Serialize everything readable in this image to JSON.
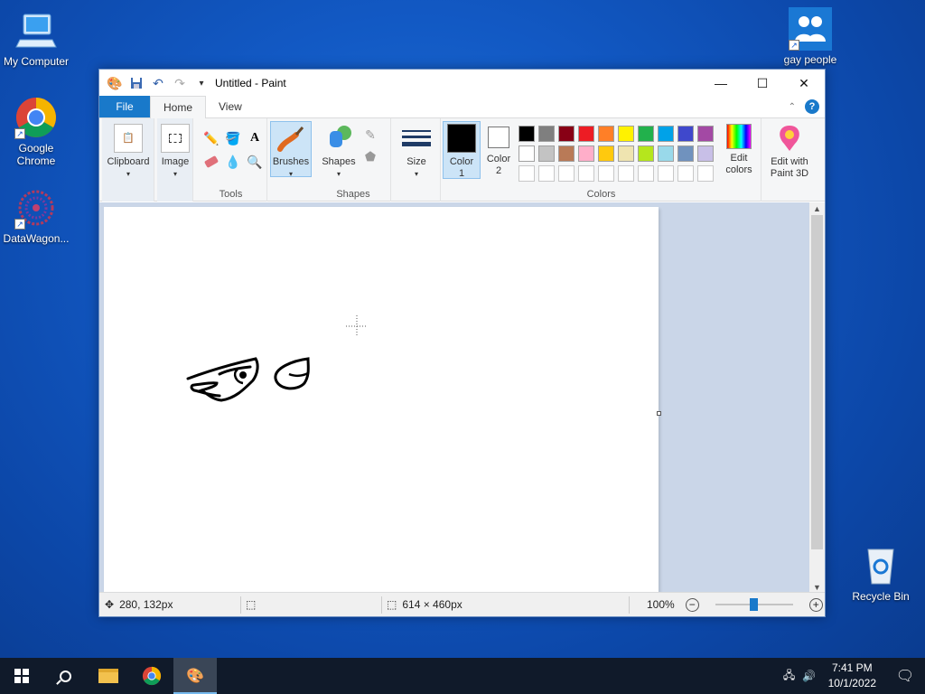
{
  "desktop": {
    "icons": [
      {
        "label": "My Computer"
      },
      {
        "label": "Google Chrome"
      },
      {
        "label": "DataWagon..."
      },
      {
        "label": "gay people"
      },
      {
        "label": "Recycle Bin"
      }
    ]
  },
  "window": {
    "title": "Untitled - Paint",
    "tabs": [
      "File",
      "Home",
      "View"
    ]
  },
  "ribbon": {
    "clipboard": "Clipboard",
    "image": "Image",
    "tools": "Tools",
    "brushes": "Brushes",
    "shapes_btn": "Shapes",
    "shapes_group": "Shapes",
    "size": "Size",
    "color1": "Color 1",
    "color2": "Color 2",
    "edit_colors": "Edit colors",
    "paint3d": "Edit with Paint 3D",
    "colors_group": "Colors",
    "palette_row1": [
      "#000000",
      "#7f7f7f",
      "#880015",
      "#ed1c24",
      "#ff7f27",
      "#fff200",
      "#22b14c",
      "#00a2e8",
      "#3f48cc",
      "#a349a4"
    ],
    "palette_row2": [
      "#ffffff",
      "#c3c3c3",
      "#b97a57",
      "#ffaec9",
      "#ffc90e",
      "#efe4b0",
      "#b5e61d",
      "#99d9ea",
      "#7092be",
      "#c8bfe7"
    ],
    "color1_value": "#000000",
    "color2_value": "#ffffff"
  },
  "status": {
    "cursor_pos": "280, 132px",
    "canvas_size": "614 × 460px",
    "zoom": "100%"
  },
  "taskbar": {
    "time": "7:41 PM",
    "date": "10/1/2022"
  }
}
